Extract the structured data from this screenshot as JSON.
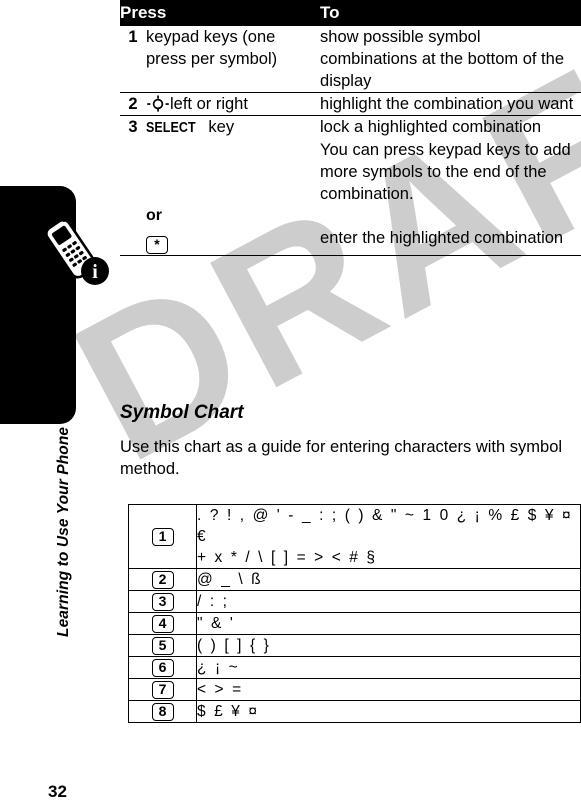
{
  "watermark": {
    "text": "DRAFT",
    "color": "#c9c9c9"
  },
  "sidebar": {
    "chapter_title": "Learning to Use Your Phone",
    "page_number": "32",
    "tab_icon": "phone-with-info-badge-icon",
    "badge_letter": "i"
  },
  "steps_table": {
    "headers": {
      "press": "Press",
      "to": "To"
    },
    "rows": [
      {
        "num": "1",
        "press": "keypad keys (one press per symbol)",
        "to": "show possible symbol combinations at the bottom of the display"
      },
      {
        "num": "2",
        "press_icon": "navigation-key-icon",
        "press": "left or right",
        "to": " highlight the combination you want"
      },
      {
        "num": "3",
        "press_softkey": "SELECT",
        "press": "key",
        "to": "lock a highlighted combination"
      },
      {
        "num": "",
        "press": "",
        "to": "You can press keypad keys to add more symbols to the end of the combination."
      },
      {
        "num": "",
        "press_or": "or",
        "press_keycap": "*",
        "to": "enter the highlighted combination"
      }
    ]
  },
  "section": {
    "heading": "Symbol Chart",
    "intro": "Use this chart as a guide for entering characters with symbol method."
  },
  "symbol_chart": {
    "rows": [
      {
        "key": "1",
        "symbols_line1": ". ? ! , @ ' - _ : ; ( ) & \" ~ 1 0 ¿ ¡ % £ $ ¥ ¤ €",
        "symbols_line2": "+ x * / \\ [ ] = > < # §"
      },
      {
        "key": "2",
        "symbols_line1": "@ _ \\   ß",
        "symbols_line2": ""
      },
      {
        "key": "3",
        "symbols_line1": "/ : ;",
        "symbols_line2": ""
      },
      {
        "key": "4",
        "symbols_line1": "\" & '",
        "symbols_line2": ""
      },
      {
        "key": "5",
        "symbols_line1": "( ) [ ] { }",
        "symbols_line2": ""
      },
      {
        "key": "6",
        "symbols_line1": "¿ ¡ ~",
        "symbols_line2": ""
      },
      {
        "key": "7",
        "symbols_line1": "< > =",
        "symbols_line2": ""
      },
      {
        "key": "8",
        "symbols_line1": "$ £ ¥ ¤",
        "symbols_line2": ""
      }
    ]
  }
}
